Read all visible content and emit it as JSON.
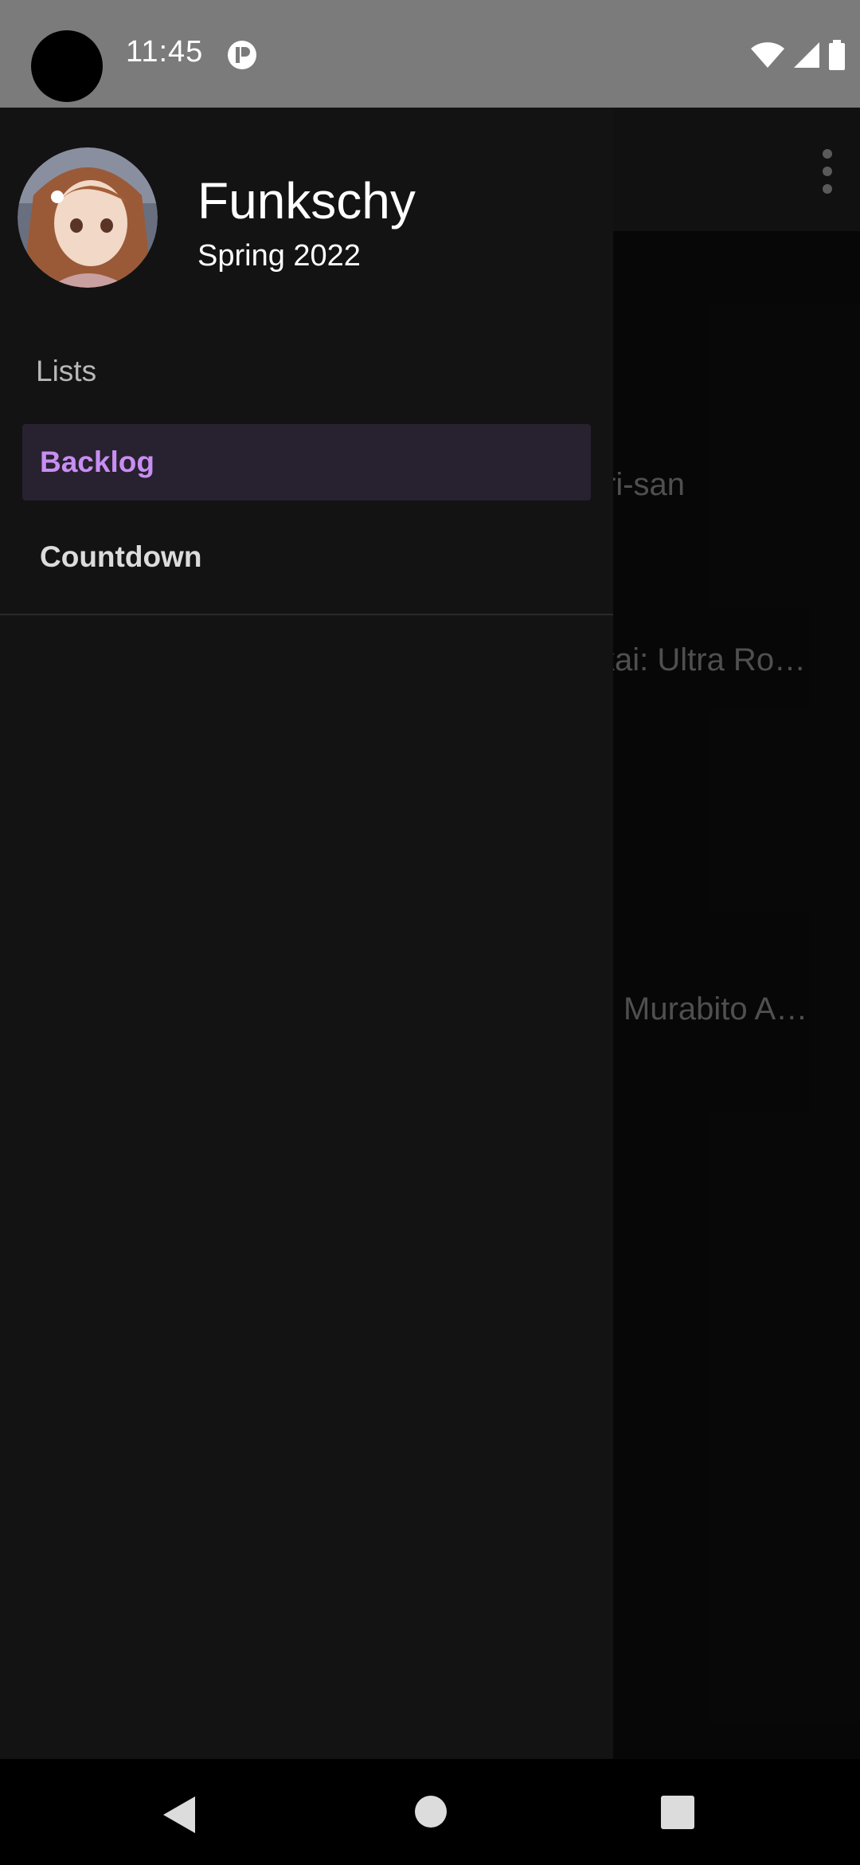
{
  "status_bar": {
    "time": "11:45",
    "icons": [
      "camera-cutout",
      "app-notification-icon",
      "wifi-icon",
      "cellular-signal-icon",
      "battery-icon"
    ]
  },
  "background_app": {
    "list_items": [
      "ri-san",
      "kai: Ultra Ro…",
      "Murabito A…"
    ]
  },
  "drawer": {
    "username": "Funkschy",
    "season": "Spring 2022",
    "section_header": "Lists",
    "items": [
      {
        "label": "Backlog",
        "active": true
      },
      {
        "label": "Countdown",
        "active": false
      }
    ],
    "colors": {
      "background": "#131313",
      "active_bg": "#28212f",
      "active_text": "#c88ef2"
    }
  },
  "navigation_bar": {
    "buttons": [
      "back-icon",
      "home-icon",
      "recents-icon"
    ]
  }
}
